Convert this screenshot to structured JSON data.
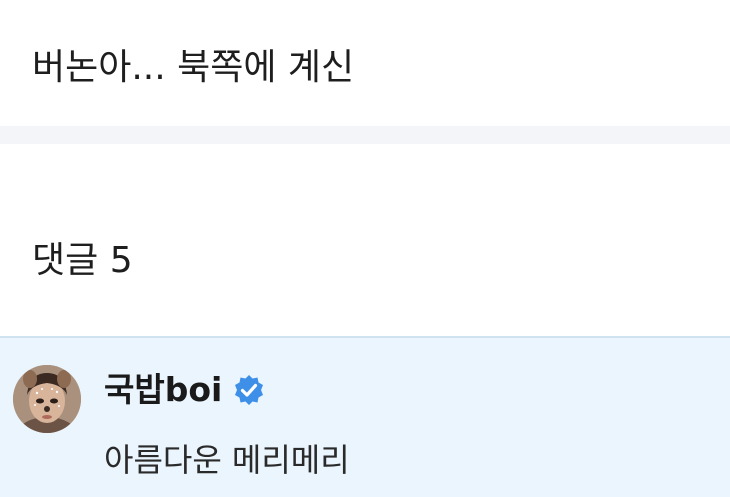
{
  "post": {
    "text": "버논아... 북쪽에 계신"
  },
  "comments": {
    "label": "댓글",
    "count": "5",
    "items": [
      {
        "author": "국밥boi",
        "verified": true,
        "text": "아름다운 메리메리"
      }
    ]
  },
  "colors": {
    "comment_highlight_bg": "#eaf5fd",
    "section_gap_bg": "#f3f5f8",
    "verified_badge": "#3d8fe8"
  }
}
